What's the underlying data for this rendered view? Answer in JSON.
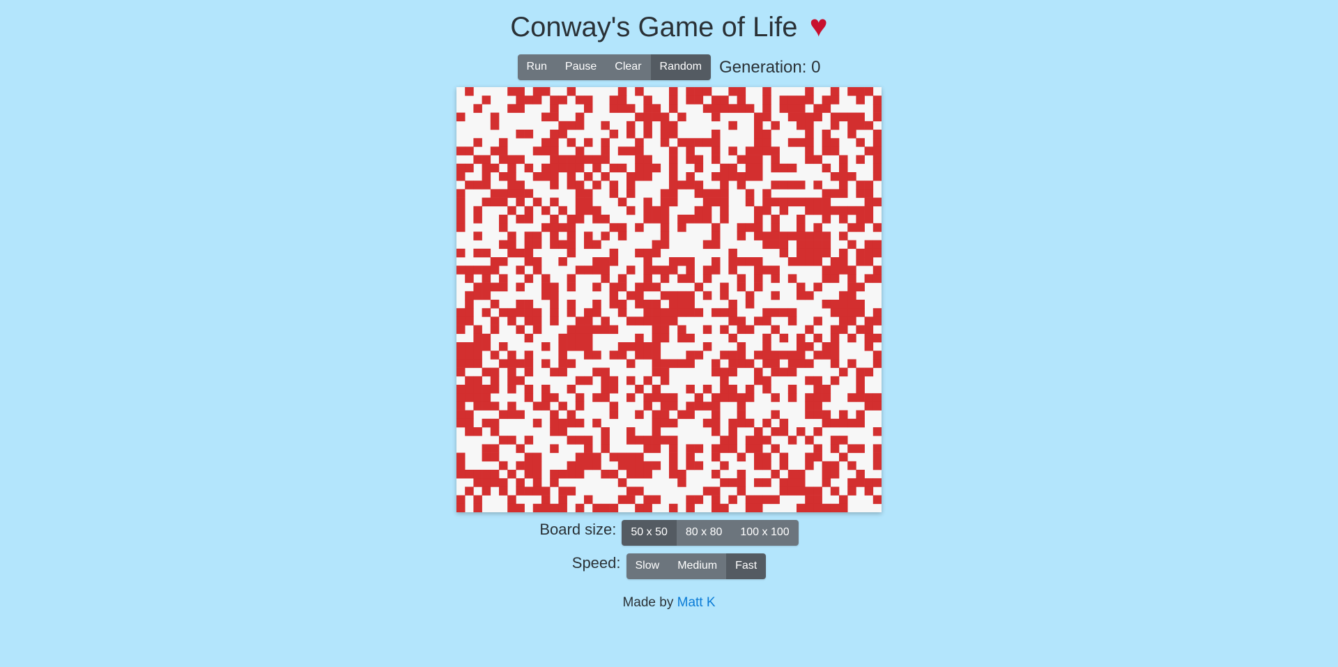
{
  "header": {
    "title": "Conway's Game of Life",
    "heart_icon": "heart-icon",
    "heart_glyph": "♥",
    "heart_color": "#c8102e"
  },
  "controls": {
    "buttons": [
      "Run",
      "Pause",
      "Clear",
      "Random"
    ],
    "active": "Random",
    "generation_label": "Generation: 0"
  },
  "board": {
    "rows": 50,
    "cols": 50,
    "alive_color": "#d32f2f",
    "dead_color": "#f7f7f7",
    "state": "randomized"
  },
  "board_size": {
    "label": "Board size:",
    "options": [
      "50 x 50",
      "80 x 80",
      "100 x 100"
    ],
    "selected": "50 x 50"
  },
  "speed": {
    "label": "Speed:",
    "options": [
      "Slow",
      "Medium",
      "Fast"
    ],
    "selected": "Fast"
  },
  "footer": {
    "prefix": "Made by ",
    "author": "Matt K"
  },
  "colors": {
    "background": "#b3e5fc",
    "button": "#6c757d",
    "button_active": "#545b62",
    "link": "#0a7bd6"
  }
}
